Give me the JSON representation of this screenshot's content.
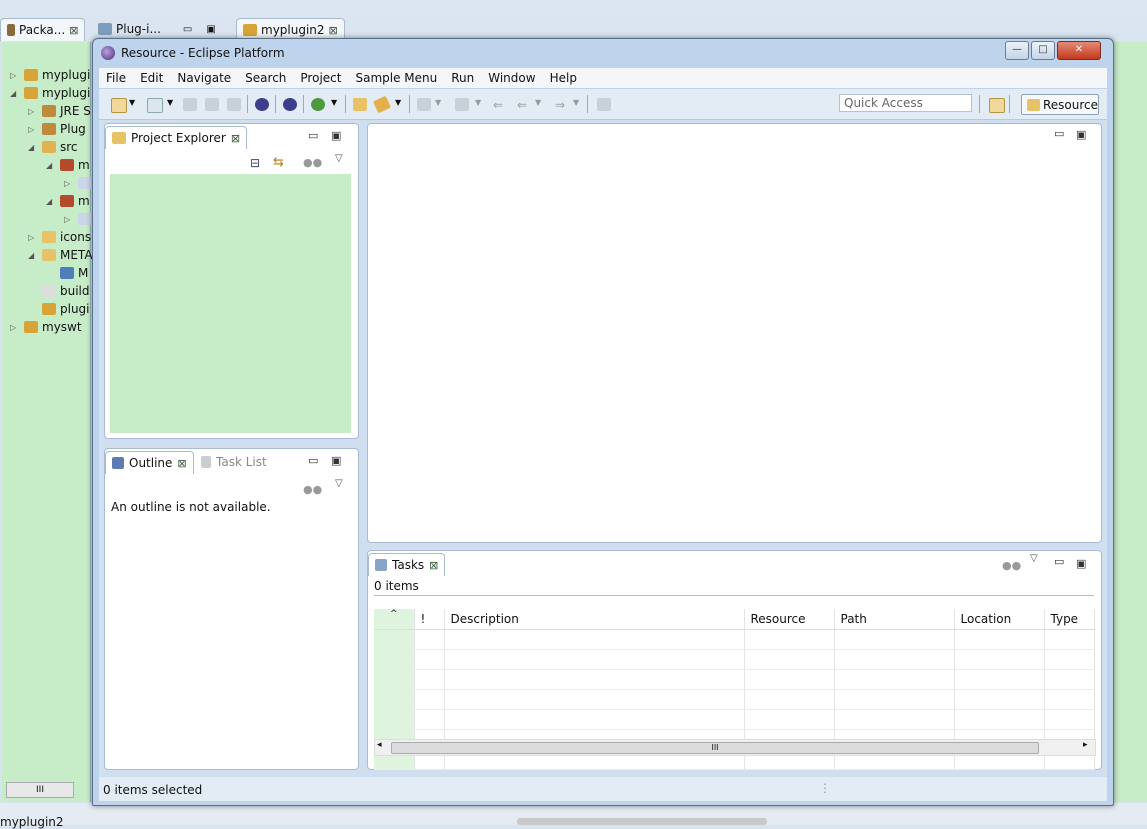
{
  "background": {
    "tabs": [
      {
        "label": "Packa...",
        "active": true
      },
      {
        "label": "Plug-i...",
        "active": false
      },
      {
        "label": "myplugin2",
        "active": false
      }
    ],
    "tree": [
      {
        "label": "myplugi",
        "expanded": false,
        "indent": 0,
        "icon": "project-icon"
      },
      {
        "label": "myplugi",
        "expanded": true,
        "indent": 0,
        "icon": "project-icon"
      },
      {
        "label": "JRE S",
        "expanded": false,
        "indent": 1,
        "icon": "library-icon"
      },
      {
        "label": "Plug",
        "expanded": false,
        "indent": 1,
        "icon": "library-icon"
      },
      {
        "label": "src",
        "expanded": true,
        "indent": 1,
        "icon": "source-folder-icon"
      },
      {
        "label": "m",
        "expanded": true,
        "indent": 2,
        "icon": "package-icon"
      },
      {
        "label": "",
        "expanded": false,
        "indent": 3,
        "icon": "java-file-icon"
      },
      {
        "label": "m",
        "expanded": true,
        "indent": 2,
        "icon": "package-icon"
      },
      {
        "label": "",
        "expanded": false,
        "indent": 3,
        "icon": "java-file-icon"
      },
      {
        "label": "icons",
        "expanded": false,
        "indent": 1,
        "icon": "folder-icon"
      },
      {
        "label": "META",
        "expanded": true,
        "indent": 1,
        "icon": "folder-icon"
      },
      {
        "label": "M",
        "expanded": null,
        "indent": 2,
        "icon": "manifest-icon"
      },
      {
        "label": "build",
        "expanded": null,
        "indent": 1,
        "icon": "properties-icon"
      },
      {
        "label": "plugi",
        "expanded": null,
        "indent": 1,
        "icon": "plugin-xml-icon"
      },
      {
        "label": "myswt",
        "expanded": false,
        "indent": 0,
        "icon": "project-icon"
      }
    ],
    "hscroll_label": "III",
    "status_text": "myplugin2"
  },
  "window": {
    "title": "Resource - Eclipse Platform",
    "controls": {
      "minimize": "—",
      "maximize": "□",
      "close": "✕"
    }
  },
  "menu": [
    "File",
    "Edit",
    "Navigate",
    "Search",
    "Project",
    "Sample Menu",
    "Run",
    "Window",
    "Help"
  ],
  "toolbar": {
    "quick_access_placeholder": "Quick Access",
    "perspective_label": "Resource"
  },
  "project_explorer": {
    "tab_label": "Project Explorer"
  },
  "outline": {
    "tabs": [
      "Outline",
      "Task List"
    ],
    "message": "An outline is not available."
  },
  "tasks": {
    "tab_label": "Tasks",
    "count_text": "0 items",
    "columns": [
      "",
      "!",
      "Description",
      "Resource",
      "Path",
      "Location",
      "Type"
    ],
    "sort_indicator": "^",
    "scroll_label": "III"
  },
  "status": {
    "text": "0 items selected"
  },
  "colors": {
    "accent": "#bdd4ec",
    "view_green": "#c7ecc8",
    "close_red": "#c2391f"
  }
}
